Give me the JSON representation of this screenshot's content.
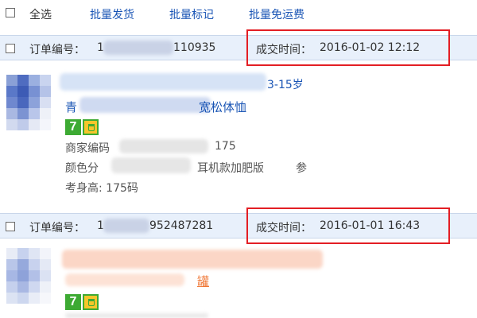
{
  "toolbar": {
    "select_all_label": "全选",
    "batch_ship_label": "批量发货",
    "batch_mark_label": "批量标记",
    "batch_free_shipping_label": "批量免运费"
  },
  "orders": [
    {
      "order_no_label": "订单编号：",
      "order_no_prefix": "1",
      "order_no_suffix": "110935",
      "deal_time_label": "成交时间：",
      "deal_time": "2016-01-02 12:12",
      "title_prefix": "青",
      "title_fragment_1": "3-15岁",
      "title_fragment_2": "宽松体恤",
      "merchant_code_label": "商家编码",
      "merchant_code_tail": "175",
      "color_label": "颜色分",
      "color_value_fragment": "耳机款加肥版",
      "color_value_tail": "参",
      "size_label": "考身高: 175码"
    },
    {
      "order_no_label": "订单编号：",
      "order_no_prefix": "1",
      "order_no_suffix": "952487281",
      "deal_time_label": "成交时间：",
      "deal_time": "2016-01-01 16:43",
      "title_fragment": "罐"
    }
  ],
  "colors": {
    "link": "#1a55b5",
    "header_bg": "#e8f0fb",
    "highlight_box": "#e31e24",
    "badge_green": "#3daa33",
    "badge_yellow": "#f6c62b"
  },
  "icons": [
    "checkbox-icon",
    "seven-day-return-icon",
    "consumer-guarantee-icon"
  ]
}
